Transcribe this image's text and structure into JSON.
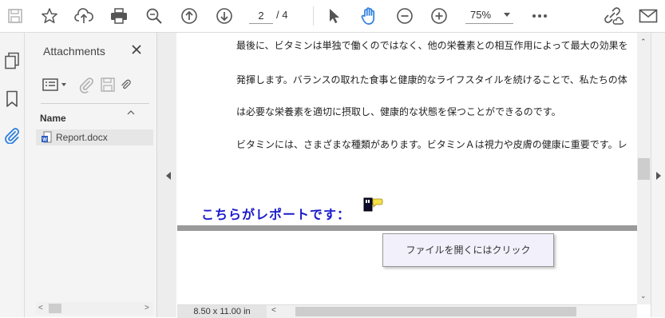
{
  "toolbar": {
    "page_current": "2",
    "page_total": "/ 4",
    "zoom": "75%",
    "icons": [
      "save-icon",
      "bookmark-star-icon",
      "upload-cloud-icon",
      "print-icon",
      "zoom-search-icon",
      "page-up-icon",
      "page-down-icon",
      "select-cursor-icon",
      "hand-tool-icon",
      "zoom-out-icon",
      "zoom-in-icon",
      "more-icon",
      "share-link-icon",
      "email-icon"
    ],
    "accent": "#2d7fe0"
  },
  "leftrail": {
    "icons": [
      "page-thumbnails-icon",
      "bookmarks-icon",
      "attachments-icon"
    ]
  },
  "attachments": {
    "title": "Attachments",
    "column_header": "Name",
    "files": [
      {
        "name": "Report.docx",
        "icon": "word-document-icon"
      }
    ]
  },
  "document": {
    "lines": [
      "最後に、ビタミンは単独で働くのではなく、他の栄養素との相互作用によって最大の効果を",
      "発揮します。バランスの取れた食事と健康的なライフスタイルを続けることで、私たちの体",
      "は必要な栄養素を適切に摂取し、健康的な状態を保つことができるのです。",
      "ビタミンには、さまざまな種類があります。ビタミンＡは視力や皮膚の健康に重要です。レ"
    ],
    "heading": "こちらがレポートです：",
    "tooltip": "ファイルを開くにはクリック",
    "heading_color": "#1a1acc"
  },
  "status": {
    "page_size": "8.50 x 11.00 in"
  }
}
